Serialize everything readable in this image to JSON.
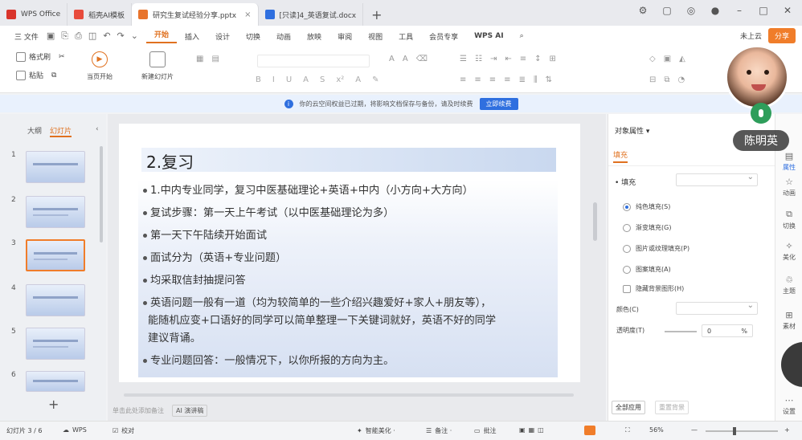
{
  "tabs": [
    {
      "label": "WPS Office",
      "icon": "wps-logo-icon",
      "color": "#d9342b"
    },
    {
      "label": "稻壳AI模板",
      "icon": "docer-icon",
      "color": "#e84b3c"
    },
    {
      "label": "研究生复试经验分享.pptx",
      "icon": "pptx-icon",
      "color": "#e8742c"
    },
    {
      "label": "[只读]4_英语复试.docx",
      "icon": "docx-icon",
      "color": "#2f6fdf"
    }
  ],
  "menu": {
    "file": "三 文件",
    "items": [
      "开始",
      "插入",
      "设计",
      "切换",
      "动画",
      "放映",
      "审阅",
      "视图",
      "工具",
      "会员专享"
    ],
    "wps_ai": "WPS AI",
    "cloud": "未上云",
    "share": "分享"
  },
  "ribbon": {
    "format_painter": "格式刷",
    "paste": "粘贴",
    "start_show": "当页开始",
    "new_slide": "新建幻灯片"
  },
  "notice": {
    "text": "你的云空间权益已过期，将影响文档保存与备份，请及时续费",
    "button": "立即续费"
  },
  "left_panel": {
    "tab_outline": "大纲",
    "tab_slides": "幻灯片",
    "slide_numbers": [
      "1",
      "2",
      "3",
      "4",
      "5",
      "6"
    ],
    "add": "+"
  },
  "slide": {
    "title": "2.复习",
    "bullets": [
      "1.中内专业同学，复习中医基础理论+英语+中内（小方向+大方向）",
      "复试步骤：第一天上午考试（以中医基础理论为多）",
      "第一天下午陆续开始面试",
      "面试分为（英语+专业问题）",
      "均采取信封抽提问答",
      "英语问题一般有一道（均为较简单的一些介绍兴趣爱好+家人+朋友等），",
      "专业问题回答：一般情况下，以你所报的方向为主。"
    ],
    "continuation": [
      "能随机应变+口语好的同学可以简单整理一下关键词就好，英语不好的同学",
      "建议背诵。"
    ],
    "notes_placeholder": "单击此处添加备注",
    "ai_notes": "AI 演讲稿"
  },
  "right_panel": {
    "title": "对象属性 ▾",
    "tab_fill": "填充",
    "fill_label": "• 填充",
    "options": [
      "纯色填充(S)",
      "渐变填充(G)",
      "图片或纹理填充(P)",
      "图案填充(A)"
    ],
    "hide_bg": "隐藏背景图形(H)",
    "color_label": "颜色(C)",
    "transparency_label": "透明度(T)",
    "transparency_value": "0",
    "percent": "%",
    "apply_all": "全部应用",
    "reset_bg": "重置背景"
  },
  "sidebar": {
    "items": [
      "属性",
      "动画",
      "切换",
      "美化",
      "主题",
      "素材",
      "设置"
    ]
  },
  "webcam": {
    "name": "陈明英"
  },
  "statusbar": {
    "slide_count": "幻灯片 3 / 6",
    "wps": "WPS",
    "proofread": "校对",
    "beautify": "智能美化 ·",
    "notes": "备注 ·",
    "comments": "批注",
    "zoom": "56%"
  },
  "colors": {
    "accent": "#e0711f",
    "share": "#f07d2a",
    "info_blue": "#2f6fdf"
  }
}
